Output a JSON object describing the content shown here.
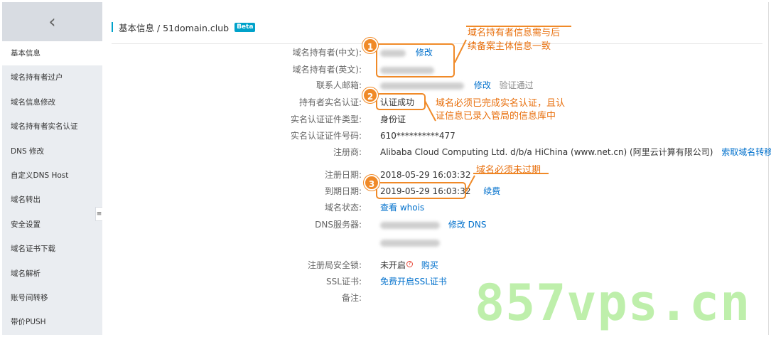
{
  "sidebar": {
    "back_icon": "chevron-left-icon",
    "items": [
      {
        "label": "基本信息",
        "active": true
      },
      {
        "label": "域名持有者过户"
      },
      {
        "label": "域名信息修改"
      },
      {
        "label": "域名持有者实名认证"
      },
      {
        "label": "DNS 修改"
      },
      {
        "label": "自定义DNS Host"
      },
      {
        "label": "域名转出"
      },
      {
        "label": "安全设置"
      },
      {
        "label": "域名证书下载"
      },
      {
        "label": "域名解析"
      },
      {
        "label": "账号间转移"
      },
      {
        "label": "带价PUSH"
      }
    ],
    "collapse_icon": "sidebar-collapse-icon"
  },
  "header": {
    "breadcrumb": "基本信息 / 51domain.club",
    "badge": "Beta"
  },
  "fields": {
    "holder_cn": {
      "label": "域名持有者(中文):",
      "action": "修改"
    },
    "holder_en": {
      "label": "域名持有者(英文):"
    },
    "email": {
      "label": "联系人邮箱:",
      "action": "修改",
      "status": "验证通过"
    },
    "realname": {
      "label": "持有者实名认证:",
      "value": "认证成功"
    },
    "cert_type": {
      "label": "实名认证证件类型:",
      "value": "身份证"
    },
    "cert_no": {
      "label": "实名认证证件号码:",
      "value": "610**********477"
    },
    "registrar": {
      "label": "注册商:",
      "value": "Alibaba Cloud Computing Ltd. d/b/a HiChina (www.net.cn) (阿里云计算有限公司)",
      "action": "索取域名转移码"
    },
    "reg_date": {
      "label": "注册日期:",
      "value": "2018-05-29 16:03:32"
    },
    "exp_date": {
      "label": "到期日期:",
      "value": "2019-05-29 16:03:32",
      "action": "续费"
    },
    "status": {
      "label": "域名状态:",
      "action": "查看 whois"
    },
    "dns": {
      "label": "DNS服务器:",
      "action": "修改 DNS"
    },
    "lock": {
      "label": "注册局安全锁:",
      "value": "未开启",
      "action": "购买"
    },
    "ssl": {
      "label": "SSL证书:",
      "action": "免费开启SSL证书"
    },
    "remark": {
      "label": "备注:"
    }
  },
  "annotations": {
    "note1": {
      "number": "1",
      "line1": "域名持有者信息需与后",
      "line2": "续备案主体信息一致"
    },
    "note2": {
      "number": "2",
      "line1": "域名必须已完成实名认证，且认",
      "line2": "证信息已录入管局的信息库中"
    },
    "note3": {
      "number": "3",
      "line1": "域名必须未过期"
    },
    "accent_color": "#f08a28"
  },
  "watermark": "857vps.cn",
  "colors": {
    "link": "#0070cc",
    "beta": "#00a2ca",
    "sidebar_bg": "#eaedf1"
  }
}
